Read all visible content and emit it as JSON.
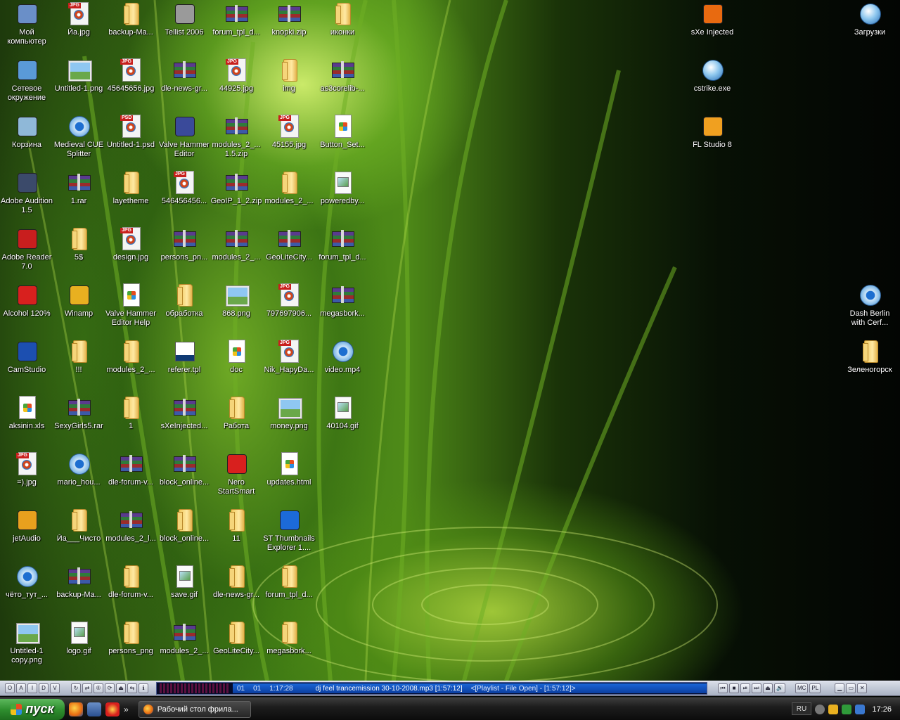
{
  "desktop": {
    "icons": [
      {
        "label": "Мой компьютер",
        "type": "app",
        "icon": "my-computer-icon",
        "color": "#6a8fc8"
      },
      {
        "label": "Сетевое окружение",
        "type": "app",
        "icon": "network-places-icon",
        "color": "#5a9ad8"
      },
      {
        "label": "Корзина",
        "type": "app",
        "icon": "recycle-bin-icon",
        "color": "#8fb8d8"
      },
      {
        "label": "Adobe Audition 1.5",
        "type": "app",
        "icon": "adobe-audition-icon",
        "color": "#3b4a6a"
      },
      {
        "label": "Adobe Reader 7.0",
        "type": "app",
        "icon": "adobe-reader-icon",
        "color": "#c81e1e"
      },
      {
        "label": "Alcohol 120%",
        "type": "app",
        "icon": "alcohol-icon",
        "color": "#d8201e"
      },
      {
        "label": "CamStudio",
        "type": "app",
        "icon": "camstudio-icon",
        "color": "#1c4fb0"
      },
      {
        "label": "aksinin.xls",
        "type": "doc",
        "icon": "excel-file-icon"
      },
      {
        "label": "=).jpg",
        "type": "jpg",
        "icon": "jpg-file-icon"
      },
      {
        "label": "jetAudio",
        "type": "app",
        "icon": "jetaudio-icon",
        "color": "#e8a01e"
      },
      {
        "label": "чёто_тут_...",
        "type": "media",
        "icon": "media-file-icon"
      },
      {
        "label": "Untitled-1 copy.png",
        "type": "png",
        "icon": "png-file-icon"
      },
      {
        "label": "Йа.jpg",
        "type": "jpg",
        "icon": "jpg-file-icon"
      },
      {
        "label": "Untitled-1.png",
        "type": "png",
        "icon": "png-file-icon"
      },
      {
        "label": "Medieval CUE Splitter",
        "type": "media",
        "icon": "cue-splitter-icon"
      },
      {
        "label": "1.rar",
        "type": "rar",
        "icon": "rar-archive-icon"
      },
      {
        "label": "5$",
        "type": "folder",
        "icon": "folder-icon"
      },
      {
        "label": "Winamp",
        "type": "app",
        "icon": "winamp-icon",
        "color": "#e8b020"
      },
      {
        "label": "!!!",
        "type": "folder",
        "icon": "folder-icon"
      },
      {
        "label": "SexyGirls5.rar",
        "type": "rar",
        "icon": "rar-archive-icon"
      },
      {
        "label": "mario_hou...",
        "type": "media",
        "icon": "media-file-icon"
      },
      {
        "label": "Йа___Чисто",
        "type": "folder",
        "icon": "folder-icon"
      },
      {
        "label": "backup-Ma...",
        "type": "rar",
        "icon": "rar-archive-icon"
      },
      {
        "label": "logo.gif",
        "type": "gif",
        "icon": "gif-file-icon"
      },
      {
        "label": "backup-Ma...",
        "type": "folder",
        "icon": "folder-icon"
      },
      {
        "label": "45645656.jpg",
        "type": "jpg",
        "icon": "jpg-file-icon"
      },
      {
        "label": "Untitled-1.psd",
        "type": "jpg",
        "icon": "psd-file-icon"
      },
      {
        "label": "layetheme",
        "type": "folder",
        "icon": "folder-icon"
      },
      {
        "label": "design.jpg",
        "type": "jpg",
        "icon": "jpg-file-icon"
      },
      {
        "label": "Valve Hammer Editor Help",
        "type": "doc",
        "icon": "help-file-icon"
      },
      {
        "label": "modules_2_...",
        "type": "folder",
        "icon": "folder-icon"
      },
      {
        "label": "1",
        "type": "folder",
        "icon": "folder-icon"
      },
      {
        "label": "dle-forum-v...",
        "type": "rar",
        "icon": "rar-archive-icon"
      },
      {
        "label": "modules_2_l...",
        "type": "rar",
        "icon": "rar-archive-icon"
      },
      {
        "label": "dle-forum-v...",
        "type": "folder",
        "icon": "folder-icon"
      },
      {
        "label": "persons_png",
        "type": "folder",
        "icon": "folder-icon"
      },
      {
        "label": "Tellist 2006",
        "type": "app",
        "icon": "skull-icon",
        "color": "#9a9a9a"
      },
      {
        "label": "dle-news-gr...",
        "type": "rar",
        "icon": "rar-archive-icon"
      },
      {
        "label": "Valve Hammer Editor",
        "type": "app",
        "icon": "valve-hammer-icon",
        "color": "#3a4a9a"
      },
      {
        "label": "546456456...",
        "type": "jpg",
        "icon": "jpg-file-icon"
      },
      {
        "label": "persons_pn...",
        "type": "rar",
        "icon": "rar-archive-icon"
      },
      {
        "label": "обработка",
        "type": "folder",
        "icon": "folder-icon"
      },
      {
        "label": "referer.tpl",
        "type": "tpl",
        "icon": "tpl-file-icon"
      },
      {
        "label": "sXeInjected...",
        "type": "rar",
        "icon": "rar-archive-icon"
      },
      {
        "label": "block_online...",
        "type": "rar",
        "icon": "rar-archive-icon"
      },
      {
        "label": "block_online...",
        "type": "folder",
        "icon": "folder-icon"
      },
      {
        "label": "save.gif",
        "type": "gif",
        "icon": "gif-file-icon"
      },
      {
        "label": "modules_2_...",
        "type": "rar",
        "icon": "rar-archive-icon"
      },
      {
        "label": "forum_tpl_d...",
        "type": "rar",
        "icon": "rar-archive-icon"
      },
      {
        "label": "44925.jpg",
        "type": "jpg",
        "icon": "jpg-file-icon"
      },
      {
        "label": "modules_2_... 1.5.zip",
        "type": "rar",
        "icon": "rar-archive-icon"
      },
      {
        "label": "GeoIP_1_2.zip",
        "type": "rar",
        "icon": "rar-archive-icon"
      },
      {
        "label": "modules_2_...",
        "type": "rar",
        "icon": "rar-archive-icon"
      },
      {
        "label": "868.png",
        "type": "png",
        "icon": "png-file-icon"
      },
      {
        "label": "doc",
        "type": "doc",
        "icon": "doc-file-icon"
      },
      {
        "label": "Работа",
        "type": "folder",
        "icon": "folder-icon"
      },
      {
        "label": "Nero StartSmart",
        "type": "app",
        "icon": "nero-icon",
        "color": "#d8201e"
      },
      {
        "label": "11",
        "type": "folder",
        "icon": "folder-icon"
      },
      {
        "label": "dle-news-gr...",
        "type": "folder",
        "icon": "folder-icon"
      },
      {
        "label": "GeoLiteCity...",
        "type": "folder",
        "icon": "folder-icon"
      },
      {
        "label": "knopki.zip",
        "type": "rar",
        "icon": "rar-archive-icon"
      },
      {
        "label": "img",
        "type": "folder",
        "icon": "folder-icon"
      },
      {
        "label": "45155.jpg",
        "type": "jpg",
        "icon": "jpg-file-icon"
      },
      {
        "label": "modules_2_...",
        "type": "folder",
        "icon": "folder-icon"
      },
      {
        "label": "GeoLiteCity...",
        "type": "rar",
        "icon": "rar-archive-icon"
      },
      {
        "label": "797697906...",
        "type": "jpg",
        "icon": "jpg-file-icon"
      },
      {
        "label": "Nik_HapyDa...",
        "type": "jpg",
        "icon": "jpg-file-icon"
      },
      {
        "label": "money.png",
        "type": "png",
        "icon": "png-file-icon"
      },
      {
        "label": "updates.html",
        "type": "doc",
        "icon": "html-file-icon"
      },
      {
        "label": "ST Thumbnails Explorer 1....",
        "type": "app",
        "icon": "st-thumbnails-icon",
        "color": "#1c6ad8"
      },
      {
        "label": "forum_tpl_d...",
        "type": "folder",
        "icon": "folder-icon"
      },
      {
        "label": "megasbork...",
        "type": "folder",
        "icon": "folder-icon"
      },
      {
        "label": "иконки",
        "type": "folder",
        "icon": "folder-icon"
      },
      {
        "label": "as3corelib-...",
        "type": "rar",
        "icon": "rar-archive-icon"
      },
      {
        "label": "Button_Set...",
        "type": "doc",
        "icon": "doc-file-icon"
      },
      {
        "label": "poweredby...",
        "type": "gif",
        "icon": "gif-file-icon"
      },
      {
        "label": "forum_tpl_d...",
        "type": "rar",
        "icon": "rar-archive-icon"
      },
      {
        "label": "megasbork...",
        "type": "rar",
        "icon": "rar-archive-icon"
      },
      {
        "label": "video.mp4",
        "type": "media",
        "icon": "media-file-icon"
      },
      {
        "label": "40104.gif",
        "type": "gif",
        "icon": "gif-file-icon"
      },
      {
        "label": "sXe Injected",
        "type": "app",
        "icon": "sxe-injected-icon",
        "color": "#e86a10"
      },
      {
        "label": "cstrike.exe",
        "type": "exe",
        "icon": "counter-strike-icon"
      },
      {
        "label": "FL Studio 8",
        "type": "app",
        "icon": "fl-studio-icon",
        "color": "#f0a020"
      },
      {
        "label": "Загрузки",
        "type": "exe",
        "icon": "downloads-globe-icon"
      },
      {
        "label": "Dash Berlin with Cerf...",
        "type": "media",
        "icon": "media-file-icon"
      },
      {
        "label": "Зеленогорск",
        "type": "folder",
        "icon": "folder-icon"
      }
    ]
  },
  "winamp": {
    "left_buttons": [
      "O",
      "A",
      "I",
      "D",
      "V"
    ],
    "track_num": "01",
    "track_num2": "01",
    "time": "1:17:28",
    "title": "dj feel trancemission 30-10-2008.mp3 [1:57:12]",
    "playlist": "<[Playlist - File Open] - [1:57:12]>",
    "right_buttons": [
      "MC",
      "PL"
    ]
  },
  "taskbar": {
    "start_label": "пуск",
    "task_label": "Рабочий стол фрила...",
    "quicklaunch_more": "»",
    "lang": "RU",
    "clock": "17:26"
  }
}
